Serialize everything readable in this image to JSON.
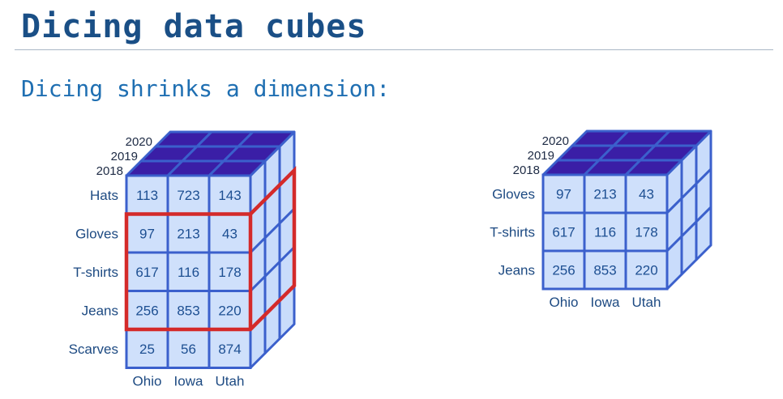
{
  "slide": {
    "title": "Dicing data cubes",
    "subtitle": "Dicing shrinks a dimension:"
  },
  "colors": {
    "title": "#1a4f86",
    "subtitle": "#1f6fb2",
    "cube_edge": "#3b60cc",
    "cell_fill": "#cfe0fb",
    "top_face": "#3a1ea6",
    "side_face": "#c9dcfb",
    "highlight": "#d42a2a"
  },
  "left_cube": {
    "years": [
      "2020",
      "2019",
      "2018"
    ],
    "rows": [
      "Hats",
      "Gloves",
      "T-shirts",
      "Jeans",
      "Scarves"
    ],
    "columns": [
      "Ohio",
      "Iowa",
      "Utah"
    ],
    "values": [
      [
        "113",
        "723",
        "143"
      ],
      [
        "97",
        "213",
        "43"
      ],
      [
        "617",
        "116",
        "178"
      ],
      [
        "256",
        "853",
        "220"
      ],
      [
        "25",
        "56",
        "874"
      ]
    ]
  },
  "right_cube": {
    "years": [
      "2020",
      "2019",
      "2018"
    ],
    "rows": [
      "Gloves",
      "T-shirts",
      "Jeans"
    ],
    "columns": [
      "Ohio",
      "Iowa",
      "Utah"
    ],
    "values": [
      [
        "97",
        "213",
        "43"
      ],
      [
        "617",
        "116",
        "178"
      ],
      [
        "256",
        "853",
        "220"
      ]
    ]
  }
}
